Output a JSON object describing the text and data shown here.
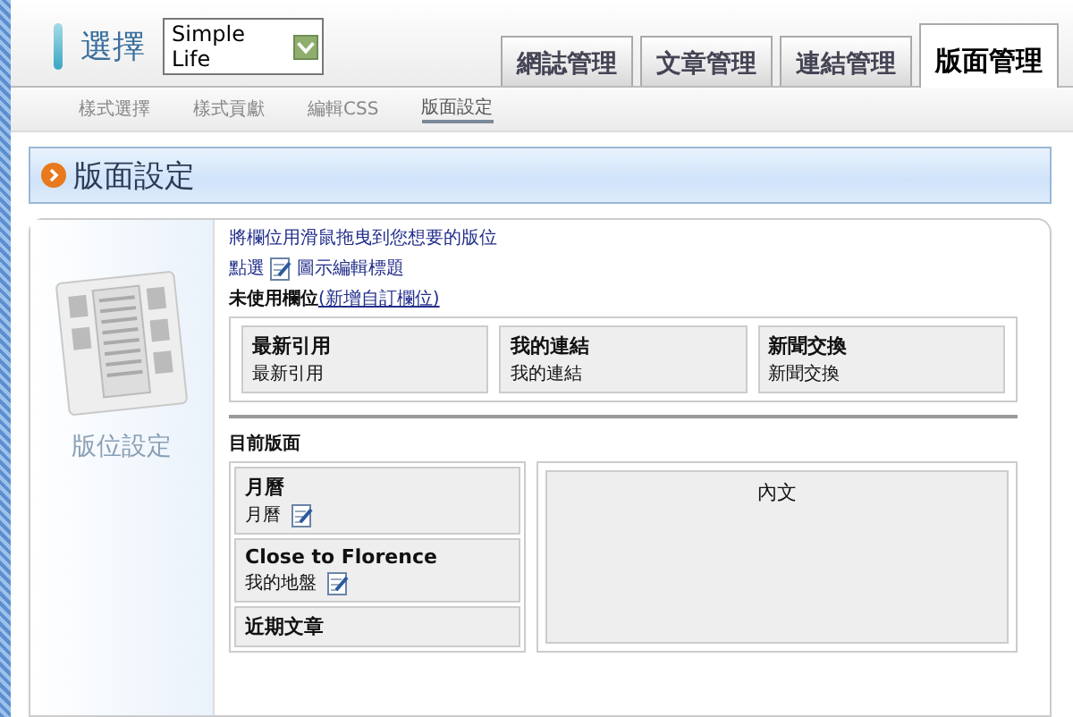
{
  "header": {
    "label": "選擇",
    "blog_select": {
      "value": "Simple Life"
    }
  },
  "tabs": [
    {
      "label": "網誌管理",
      "selected": false
    },
    {
      "label": "文章管理",
      "selected": false
    },
    {
      "label": "連結管理",
      "selected": false
    },
    {
      "label": "版面管理",
      "selected": true
    }
  ],
  "subnav": [
    {
      "label": "樣式選擇",
      "selected": false
    },
    {
      "label": "樣式貢獻",
      "selected": false
    },
    {
      "label": "編輯CSS",
      "selected": false
    },
    {
      "label": "版面設定",
      "selected": true
    }
  ],
  "page_title": "版面設定",
  "sidebar": {
    "label": "版位設定"
  },
  "instructions": "將欄位用滑鼠拖曳到您想要的版位",
  "hint": {
    "before": "點選",
    "after": "圖示編輯標題"
  },
  "unused": {
    "label": "未使用欄位",
    "link": "(新增自訂欄位)",
    "widgets": [
      {
        "title": "最新引用",
        "name": "最新引用"
      },
      {
        "title": "我的連結",
        "name": "我的連結"
      },
      {
        "title": "新聞交換",
        "name": "新聞交換"
      }
    ]
  },
  "current": {
    "label": "目前版面",
    "sidebar_widgets": [
      {
        "title": "月曆",
        "name": "月曆",
        "editable": true
      },
      {
        "title": "Close to Florence",
        "name": "我的地盤",
        "editable": true
      },
      {
        "title": "近期文章",
        "editable": false
      }
    ],
    "main": {
      "label": "內文"
    }
  }
}
